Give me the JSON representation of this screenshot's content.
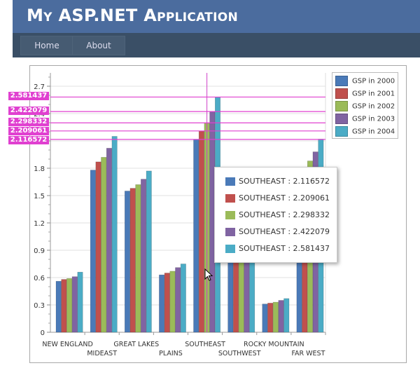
{
  "header": {
    "title": "My ASP.NET Application"
  },
  "nav": {
    "items": [
      {
        "label": "Home"
      },
      {
        "label": "About"
      }
    ]
  },
  "chart_data": {
    "type": "bar",
    "categories": [
      "NEW ENGLAND",
      "MIDEAST",
      "GREAT LAKES",
      "PLAINS",
      "SOUTHEAST",
      "SOUTHWEST",
      "ROCKY MOUNTAIN",
      "FAR WEST"
    ],
    "series": [
      {
        "name": "GSP in 2000",
        "color": "#4a7ab8",
        "values": [
          0.56,
          1.78,
          1.55,
          0.63,
          2.116572,
          0.95,
          0.31,
          1.75
        ]
      },
      {
        "name": "GSP in 2001",
        "color": "#c0504d",
        "values": [
          0.58,
          1.87,
          1.58,
          0.65,
          2.209061,
          1.0,
          0.32,
          1.8
        ]
      },
      {
        "name": "GSP in 2002",
        "color": "#9bbb59",
        "values": [
          0.59,
          1.92,
          1.62,
          0.67,
          2.298332,
          1.05,
          0.33,
          1.88
        ]
      },
      {
        "name": "GSP in 2003",
        "color": "#8064a2",
        "values": [
          0.61,
          2.02,
          1.68,
          0.71,
          2.422079,
          1.1,
          0.35,
          1.98
        ]
      },
      {
        "name": "GSP in 2004",
        "color": "#4bacc6",
        "values": [
          0.66,
          2.15,
          1.77,
          0.75,
          2.581437,
          1.17,
          0.37,
          2.12
        ]
      }
    ],
    "yticks": [
      "0",
      "0.3",
      "0.6",
      "0.9",
      "1.2",
      "1.5",
      "1.8",
      "2.1",
      "2.4",
      "2.7"
    ],
    "ylim": [
      0,
      2.8
    ],
    "grid": true,
    "legend": "top-right",
    "crosshair": {
      "category": "SOUTHEAST",
      "labels": [
        "2.581437",
        "2.422079",
        "2.298332",
        "2.209061",
        "2.116572"
      ]
    },
    "tooltip": [
      {
        "text": "SOUTHEAST : 2.116572",
        "color": "#4a7ab8"
      },
      {
        "text": "SOUTHEAST : 2.209061",
        "color": "#c0504d"
      },
      {
        "text": "SOUTHEAST : 2.298332",
        "color": "#9bbb59"
      },
      {
        "text": "SOUTHEAST : 2.422079",
        "color": "#8064a2"
      },
      {
        "text": "SOUTHEAST : 2.581437",
        "color": "#4bacc6"
      }
    ]
  }
}
